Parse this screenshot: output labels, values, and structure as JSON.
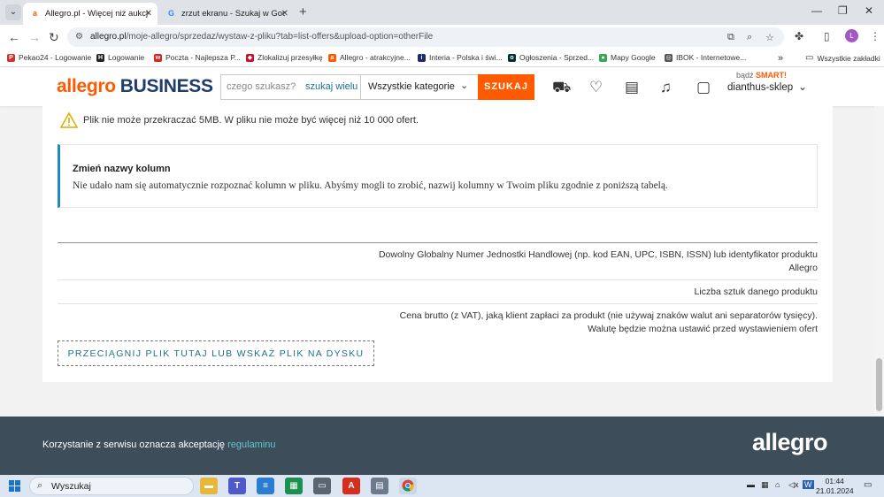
{
  "browser": {
    "tabs": [
      {
        "title": "Allegro.pl - Więcej niż aukcje. N",
        "favicon": "a",
        "active": true
      },
      {
        "title": "zrzut ekranu - Szukaj w Google",
        "favicon": "G",
        "active": false
      }
    ],
    "new_tab": "+",
    "url_host": "allegro.pl",
    "url_path": "/moje-allegro/sprzedaz/wystaw-z-pliku?tab=list-offers&upload-option=otherFile",
    "bookmarks": [
      "Pekao24 - Logowanie",
      "Logowanie",
      "Poczta - Najlepsza P...",
      "Zlokalizuj przesyłkę",
      "Allegro - atrakcyjne...",
      "Interia - Polska i świ...",
      "Ogłoszenia - Sprzed...",
      "Mapy Google",
      "IBOK - Internetowe...",
      "Wszystkie zakładki"
    ],
    "profile_initial": "L"
  },
  "header": {
    "logo_main": "allegro",
    "logo_business": "BUSINESS",
    "search_placeholder": "czego szukasz?",
    "search_wide": "szukaj wielu",
    "category": "Wszystkie kategorie",
    "search_button": "SZUKAJ",
    "smart_prefix": "bądź",
    "smart_brand": "SMART!",
    "username": "dianthus-sklep"
  },
  "main": {
    "warning": "Plik nie może przekraczać 5MB. W pliku nie może być więcej niż 10 000 ofert.",
    "notice_title": "Zmień nazwy kolumn",
    "notice_body": "Nie udało nam się automatycznie rozpoznać kolumn w pliku. Abyśmy mogli to zrobić, nazwij kolumny w Twoim pliku zgodnie z poniższą tabelą.",
    "columns": [
      {
        "line1": "Dowolny Globalny Numer Jednostki Handlowej (np. kod EAN, UPC, ISBN, ISSN) lub identyfikator produktu",
        "line2": "Allegro"
      },
      {
        "line1": "Liczba sztuk danego produktu",
        "line2": ""
      },
      {
        "line1": "Cena brutto (z VAT), jaką klient zapłaci za produkt (nie używaj znaków walut ani separatorów tysięcy).",
        "line2": "Walutę będzie można ustawić przed wystawieniem ofert"
      }
    ],
    "drop_button": "PRZECIĄGNIJ PLIK TUTAJ LUB WSKAŻ PLIK NA DYSKU"
  },
  "footer": {
    "text": "Korzystanie z serwisu oznacza akceptację",
    "link": "regulaminu",
    "logo": "allegro"
  },
  "taskbar": {
    "search_label": "Wyszukaj",
    "time": "01:44",
    "date": "21.01.2024"
  },
  "colors": {
    "brand_orange": "#ff5a00",
    "brand_navy": "#1e3c6e",
    "link_teal": "#1d6f8c",
    "notice_accent": "#1d8ac2",
    "footer_bg": "#3d4e5a"
  }
}
